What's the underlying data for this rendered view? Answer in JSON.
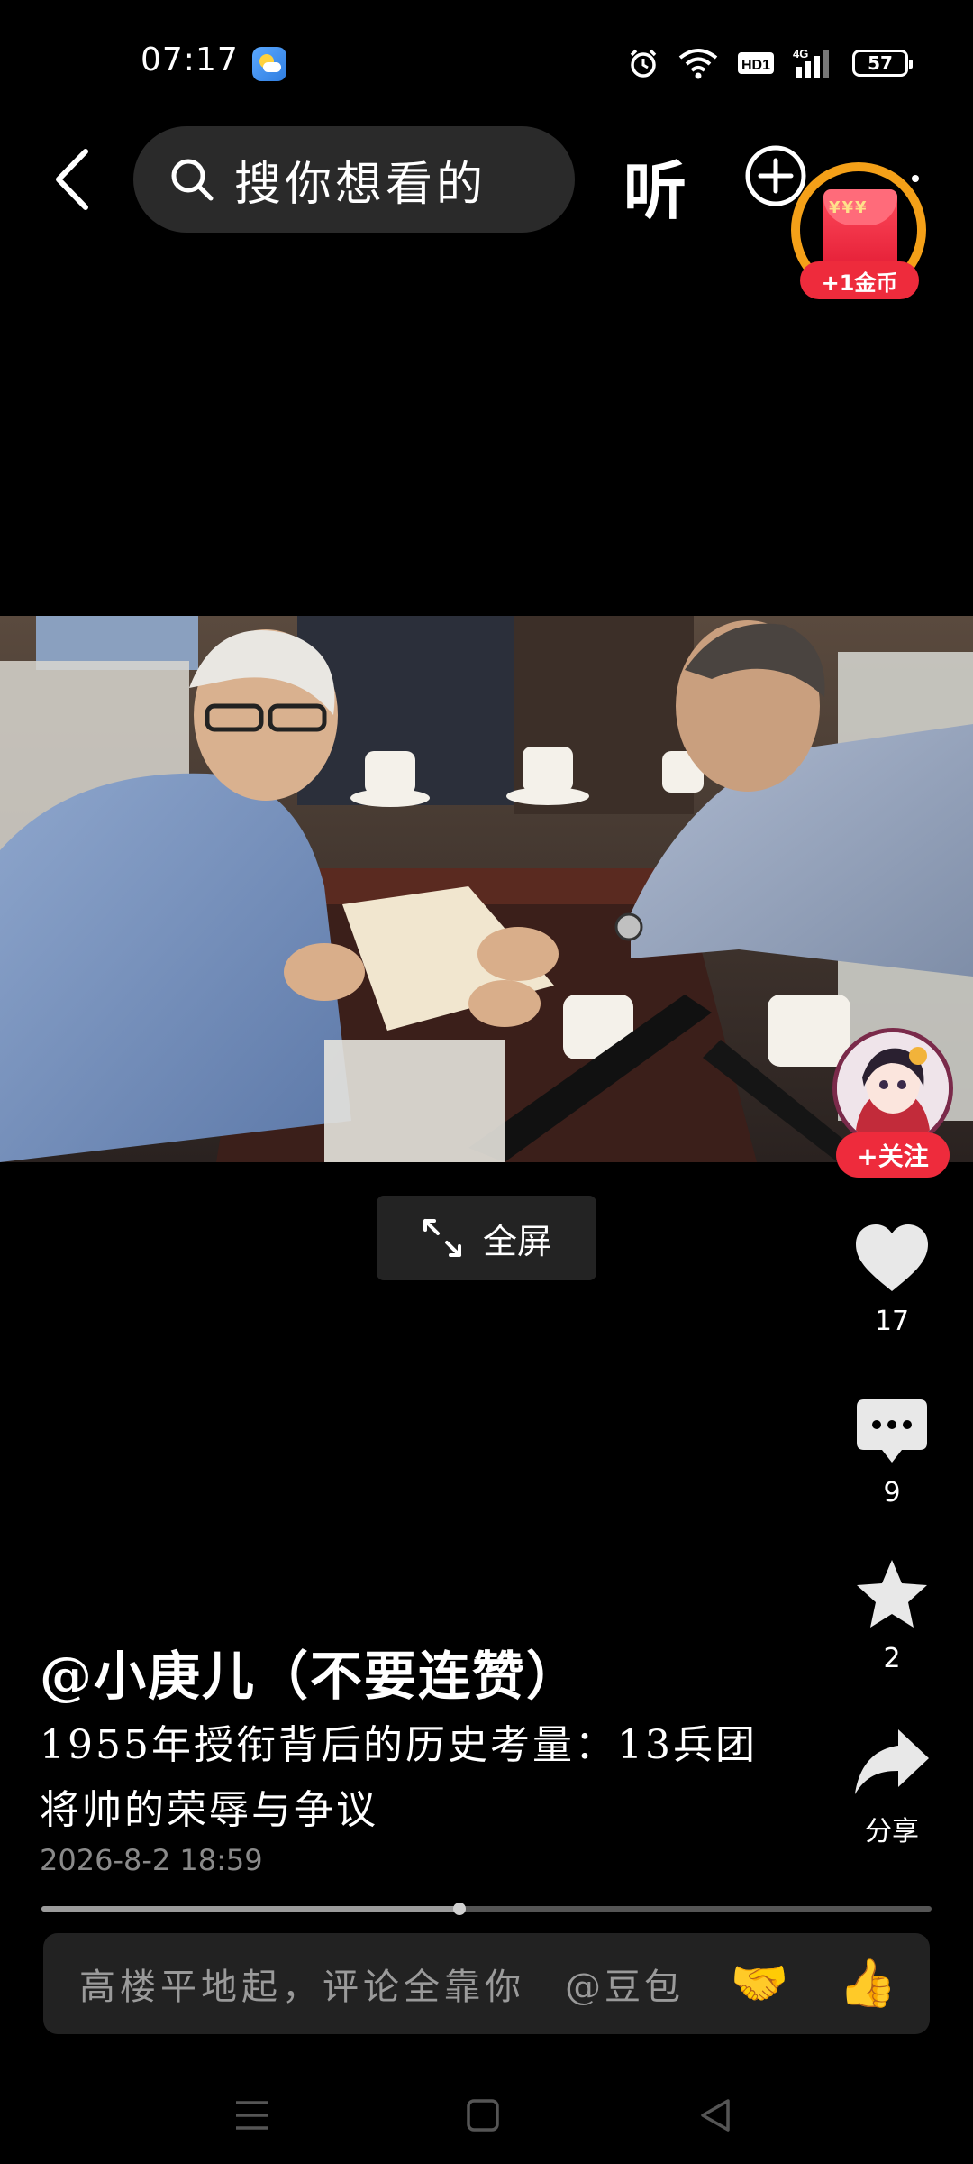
{
  "status_bar": {
    "time": "07:17",
    "battery": "57",
    "hd_label": "HD1",
    "net_label": "4G"
  },
  "top_nav": {
    "search_placeholder": "搜你想看的",
    "listen_label": "听"
  },
  "coin_badge": {
    "label": "+1金币"
  },
  "fullscreen": {
    "label": "全屏"
  },
  "sidebar": {
    "follow_label": "+关注",
    "like_count": "17",
    "comment_count": "9",
    "favorite_count": "2",
    "share_label": "分享"
  },
  "post": {
    "author": "@小庚儿（不要连赞）",
    "description": "1955年授衔背后的历史考量：13兵团将帅的荣辱与争议",
    "date": "2026-8-2 18:59"
  },
  "progress": {
    "value": 0.47
  },
  "comment_bar": {
    "placeholder": "高楼平地起，评论全靠你",
    "mention": "@豆包",
    "emoji_1": "🤝",
    "emoji_2": "👍"
  }
}
